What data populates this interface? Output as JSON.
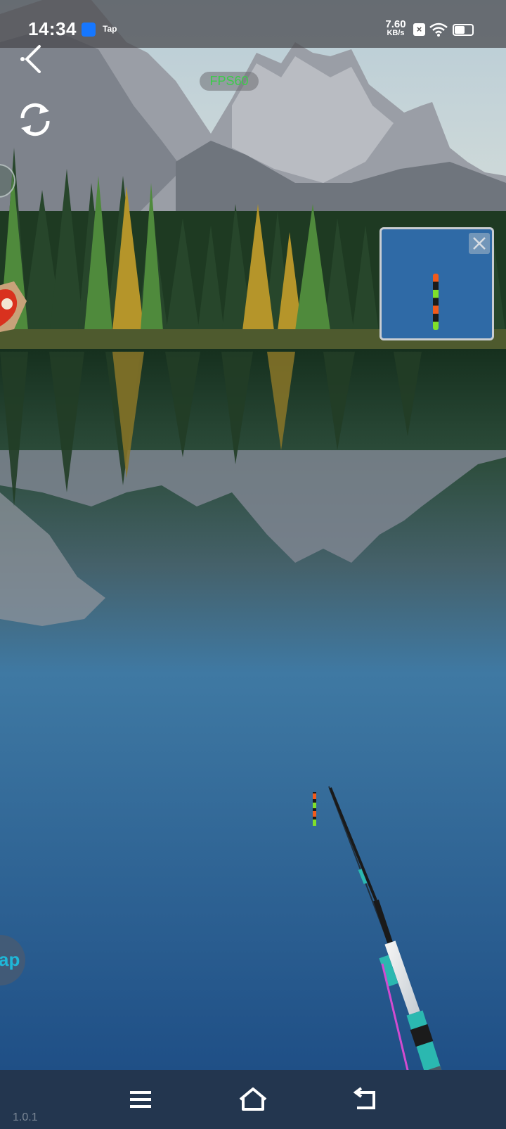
{
  "status_bar": {
    "time": "14:34",
    "app_label": "Tap",
    "net_speed_value": "7.60",
    "net_speed_unit": "KB/s",
    "icons": [
      "app-notification-icon",
      "sim-no-signal-icon",
      "wifi-icon",
      "battery-icon"
    ],
    "battery_level": 0.6
  },
  "hud": {
    "fps_label": "FPS60",
    "back_icon": "chevron-left-icon",
    "refresh_icon": "refresh-icon",
    "help_label": "ap"
  },
  "minimap": {
    "close_icon": "close-icon",
    "bobber_colors": [
      "#f25a1c",
      "#1c1c1c",
      "#7fe02a",
      "#1c1c1c",
      "#f25a1c",
      "#1c1c1c",
      "#7fe02a"
    ]
  },
  "nav_bar": {
    "icons": [
      "menu-icon",
      "home-icon",
      "back-arrow-icon"
    ]
  },
  "version": "1.0.1",
  "colors": {
    "sky": "#c9d9e0",
    "water": "#2a5f94",
    "fps_text": "#3ccb4a",
    "nav_bar": "#23364f",
    "rod_accent": "#2bb8b0"
  }
}
